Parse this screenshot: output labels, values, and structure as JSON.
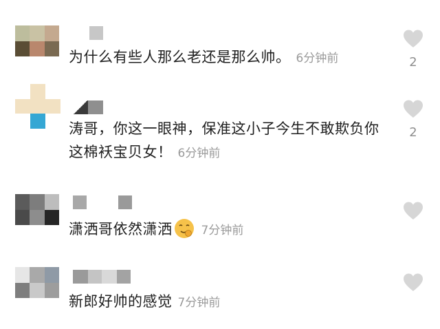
{
  "comments": [
    {
      "text": "为什么有些人那么老还是那么帅。",
      "time": "6分钟前",
      "like_count": "2"
    },
    {
      "text": "涛哥，你这一眼神，保准这小子今生不敢欺负你这棉袄宝贝女！",
      "time": "6分钟前",
      "like_count": "2"
    },
    {
      "text": "潇洒哥依然潇洒",
      "emoji": "smirk-emoji",
      "time": "7分钟前",
      "like_count": ""
    },
    {
      "text": "新郎好帅的感觉",
      "time": "7分钟前",
      "like_count": ""
    }
  ],
  "icons": {
    "like": "heart-icon"
  },
  "colors": {
    "heart": "#d6d6d6",
    "time": "#9a9a9a",
    "text": "#1f1f1f",
    "emoji": "#f6c24a"
  }
}
